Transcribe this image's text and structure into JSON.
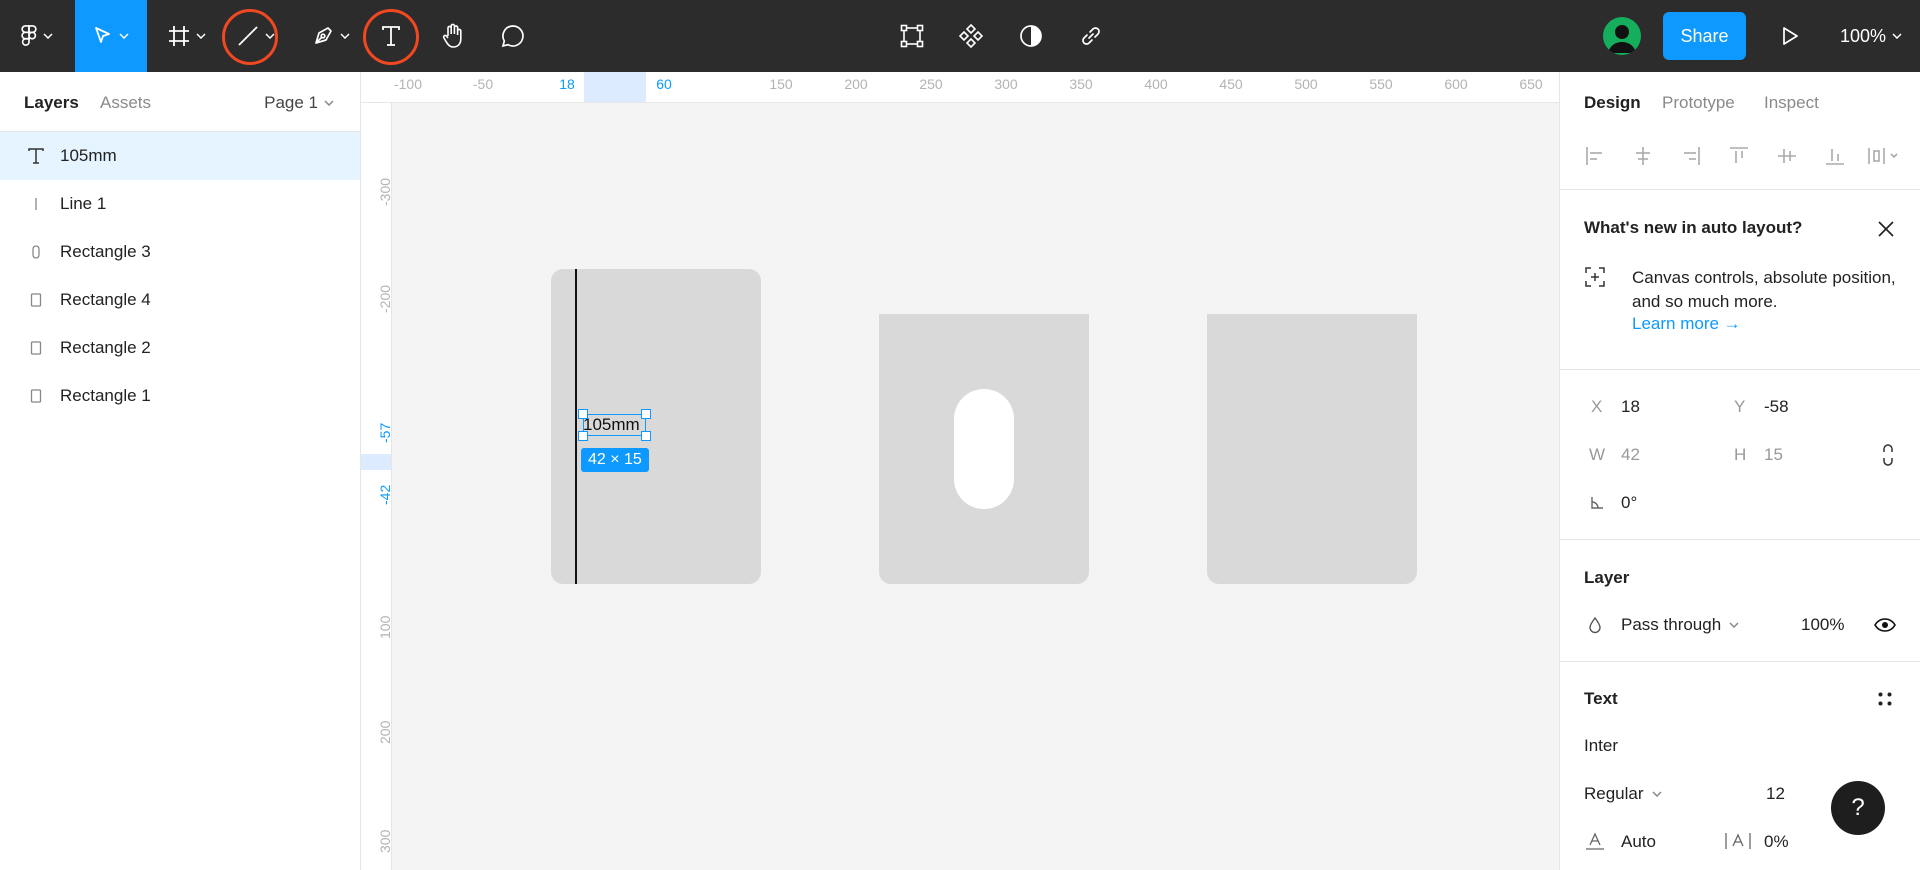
{
  "toolbar": {
    "zoom_label": "100%",
    "share_label": "Share",
    "tools": [
      {
        "name": "figma-menu",
        "icon": "figma-logo-icon"
      },
      {
        "name": "move-tool",
        "icon": "cursor-icon",
        "active": true
      },
      {
        "name": "frame-tool",
        "icon": "frame-icon"
      },
      {
        "name": "line-tool",
        "icon": "line-icon",
        "highlighted": true
      },
      {
        "name": "pen-tool",
        "icon": "pen-icon"
      },
      {
        "name": "text-tool",
        "icon": "text-icon",
        "highlighted": true
      },
      {
        "name": "hand-tool",
        "icon": "hand-icon"
      },
      {
        "name": "comment-tool",
        "icon": "comment-icon"
      }
    ],
    "center_tools": [
      "edit-object-icon",
      "component-icon",
      "mask-icon",
      "link-icon"
    ],
    "accent_color": "#0d99ff",
    "highlight_ring_color": "#f24822"
  },
  "left_panel": {
    "tabs": [
      "Layers",
      "Assets"
    ],
    "page_selector": "Page 1",
    "layers": [
      {
        "label": "105mm",
        "icon": "text-layer-icon",
        "selected": true
      },
      {
        "label": "Line 1",
        "icon": "line-layer-icon"
      },
      {
        "label": "Rectangle 3",
        "icon": "rounded-rect-layer-icon"
      },
      {
        "label": "Rectangle 4",
        "icon": "rect-layer-icon"
      },
      {
        "label": "Rectangle 2",
        "icon": "rect-layer-icon"
      },
      {
        "label": "Rectangle 1",
        "icon": "rect-layer-icon"
      }
    ]
  },
  "ruler": {
    "top_labels": [
      "-100",
      "-50",
      "18",
      "60",
      "150",
      "200",
      "250",
      "300",
      "350",
      "400",
      "450",
      "500",
      "550",
      "600",
      "650"
    ],
    "highlighted_top": [
      "18",
      "60"
    ],
    "left_labels": [
      "-300",
      "-200",
      "-57",
      "-42",
      "100",
      "200",
      "300"
    ],
    "highlighted_left": [
      "-57",
      "-42"
    ]
  },
  "canvas": {
    "text_layer_content": "105mm",
    "selection_size_label": "42 × 15"
  },
  "right_panel": {
    "tabs": [
      "Design",
      "Prototype",
      "Inspect"
    ],
    "whats_new": {
      "title": "What's new in auto layout?",
      "body": "Canvas controls, absolute position, and so much more.",
      "link": "Learn more →"
    },
    "position": {
      "x_label": "X",
      "x_value": "18",
      "y_label": "Y",
      "y_value": "-58",
      "w_label": "W",
      "w_value": "42",
      "h_label": "H",
      "h_value": "15",
      "rotation": "0°"
    },
    "layer": {
      "title": "Layer",
      "blend_mode": "Pass through",
      "opacity": "100%"
    },
    "text": {
      "title": "Text",
      "font_family": "Inter",
      "font_weight": "Regular",
      "font_size": "12",
      "line_height": "Auto",
      "letter_spacing": "0%"
    }
  },
  "help_label": "?"
}
